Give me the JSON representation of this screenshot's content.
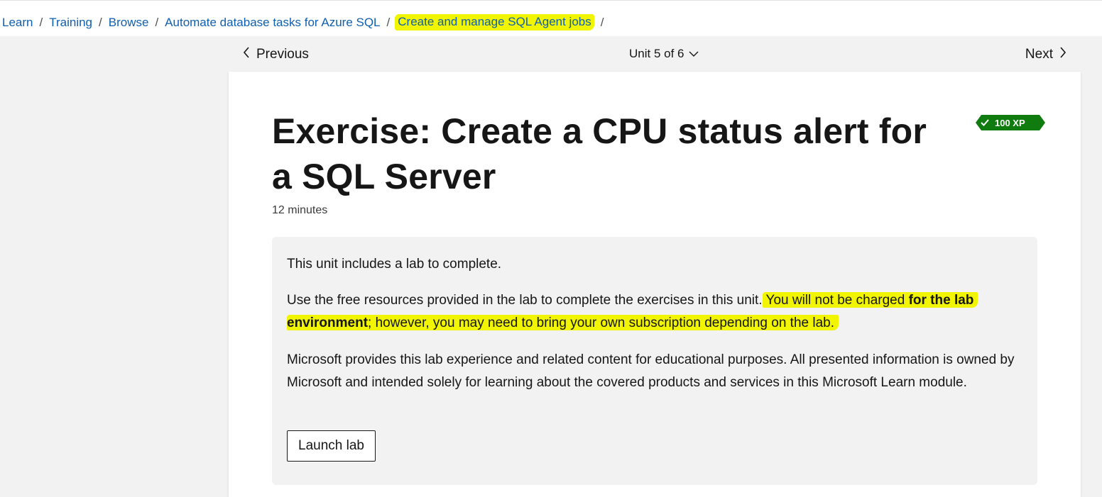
{
  "breadcrumb": {
    "items": [
      "Learn",
      "Training",
      "Browse",
      "Automate database tasks for Azure SQL",
      "Create and manage SQL Agent jobs"
    ],
    "separator": "/",
    "highlight_color": "#f2f500",
    "link_color": "#0f5fb0"
  },
  "nav": {
    "previous_label": "Previous",
    "next_label": "Next",
    "unit_label": "Unit 5 of 6",
    "icons": {
      "previous": "chevron-left-icon",
      "next": "chevron-right-icon",
      "unit": "chevron-down-icon"
    }
  },
  "unit": {
    "title": "Exercise: Create a CPU status alert for a SQL Server",
    "duration": "12 minutes",
    "xp_badge": {
      "label": "100 XP",
      "icon": "checkmark-icon",
      "color": "#107c10"
    }
  },
  "lab_box": {
    "intro": "This unit includes a lab to complete.",
    "free_resources_prefix": "Use the free resources provided in the lab to complete the exercises in this unit.",
    "charge_text_1": " You will not be charged ",
    "charge_text_bold": "for the lab environment",
    "charge_text_2": "; however, you may need to bring your own subscription depending on the lab.",
    "disclaimer": "Microsoft provides this lab experience and related content for educational purposes. All presented information is owned by Microsoft and intended solely for learning about the covered products and services in this Microsoft Learn module.",
    "launch_button_label": "Launch lab"
  }
}
